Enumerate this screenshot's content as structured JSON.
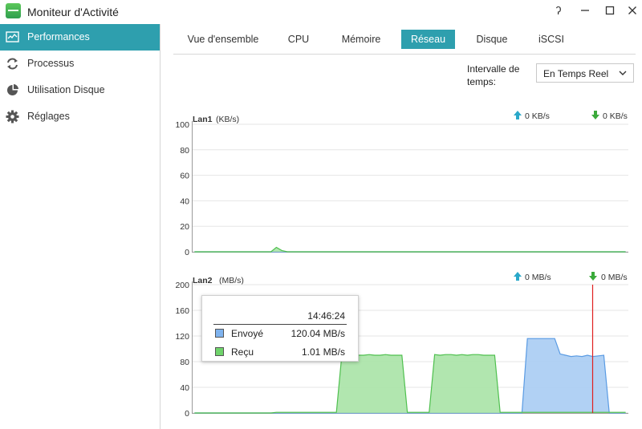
{
  "window": {
    "title": "Moniteur d'Activité",
    "buttons": [
      {
        "name": "help",
        "glyph": "ʔ"
      },
      {
        "name": "minimize"
      },
      {
        "name": "maximize"
      },
      {
        "name": "close"
      }
    ]
  },
  "sidebar": {
    "items": [
      {
        "label": "Performances",
        "icon": "performance-chart-icon",
        "active": true
      },
      {
        "label": "Processus",
        "icon": "refresh-arrows-icon",
        "active": false
      },
      {
        "label": "Utilisation Disque",
        "icon": "disk-pie-icon",
        "active": false
      },
      {
        "label": "Réglages",
        "icon": "gear-icon",
        "active": false
      }
    ]
  },
  "tabs": [
    {
      "label": "Vue d'ensemble",
      "active": false
    },
    {
      "label": "CPU",
      "active": false
    },
    {
      "label": "Mémoire",
      "active": false
    },
    {
      "label": "Réseau",
      "active": true
    },
    {
      "label": "Disque",
      "active": false
    },
    {
      "label": "iSCSI",
      "active": false
    }
  ],
  "interval": {
    "label": "Intervalle de temps:",
    "label_line1": "Intervalle de",
    "label_line2": "temps:",
    "selected": "En Temps Reel"
  },
  "colors": {
    "accent": "#2e9fae",
    "sent_fill": "#a8ccf3",
    "sent_line": "#5a9be3",
    "received_fill": "#a9e3a6",
    "received_line": "#4fc04f",
    "upload_arrow": "#2aa8c9",
    "download_arrow": "#3aaa3a",
    "cursor_line": "#e02020"
  },
  "chart_data": [
    {
      "type": "area",
      "title": "Lan1",
      "unit": "(KB/s)",
      "ylim": [
        0,
        100
      ],
      "yticks": [
        0,
        20,
        40,
        60,
        80,
        100
      ],
      "grid": true,
      "upload_rate": "0 KB/s",
      "download_rate": "0 KB/s",
      "series": [
        {
          "name": "Envoyé",
          "values": [
            0,
            0,
            0,
            0,
            0,
            0,
            0,
            0,
            0,
            0,
            0,
            0,
            0,
            0,
            0,
            0,
            0,
            0,
            0,
            0,
            0,
            0,
            0,
            0,
            0,
            0,
            0,
            0,
            0,
            0,
            0,
            0,
            0,
            0,
            0,
            0,
            0,
            0,
            0,
            0,
            0,
            0,
            0,
            0,
            0,
            0,
            0,
            0,
            0,
            0,
            0,
            0,
            0,
            0,
            0,
            0,
            0,
            0,
            0,
            0,
            0,
            0,
            0,
            0,
            0,
            0,
            0,
            0,
            0,
            0,
            0,
            0,
            0,
            0,
            0,
            0,
            0,
            0,
            0,
            0
          ]
        },
        {
          "name": "Reçu",
          "values": [
            0,
            0,
            0,
            0,
            0,
            0,
            0,
            0,
            0,
            0,
            0,
            0,
            0,
            0,
            0,
            3.5,
            1,
            0,
            0,
            0,
            0,
            0,
            0,
            0,
            0,
            0,
            0,
            0,
            0,
            0,
            0,
            0,
            0,
            0,
            0,
            0,
            0,
            0,
            0,
            0,
            0,
            0,
            0,
            0,
            0,
            0,
            0,
            0,
            0,
            0,
            0,
            0,
            0,
            0,
            0,
            0,
            0,
            0,
            0,
            0,
            0,
            0,
            0,
            0,
            0,
            0,
            0,
            0,
            0,
            0,
            0,
            0,
            0,
            0,
            0,
            0,
            0,
            0,
            0,
            0
          ]
        }
      ]
    },
    {
      "type": "area",
      "title": "Lan2",
      "unit": "(MB/s)",
      "ylim": [
        0,
        200
      ],
      "yticks": [
        0,
        40,
        80,
        120,
        160,
        200
      ],
      "grid": true,
      "upload_rate": "0 MB/s",
      "download_rate": "0 MB/s",
      "series": [
        {
          "name": "Envoyé",
          "values": [
            0,
            0,
            0,
            0,
            0,
            0,
            0,
            0,
            0,
            0,
            0,
            0,
            0,
            0,
            0,
            0,
            0,
            0,
            0,
            0,
            0,
            0,
            0,
            0,
            0,
            0,
            0,
            0,
            0,
            0,
            0,
            0,
            0,
            0,
            0,
            0,
            0,
            0,
            0,
            0,
            0,
            0,
            0,
            0,
            0,
            0,
            0,
            0,
            0,
            0,
            0,
            0,
            0,
            0,
            0,
            0,
            0,
            0,
            0,
            0,
            0,
            116,
            116,
            116,
            116,
            116,
            116,
            92,
            90,
            88,
            89,
            88,
            90,
            88,
            89,
            90,
            0,
            0,
            0,
            0
          ]
        },
        {
          "name": "Reçu",
          "values": [
            0,
            0,
            0,
            0,
            0,
            0,
            0,
            0,
            0,
            0,
            0,
            0,
            0,
            0,
            0,
            1,
            1,
            1,
            1,
            1,
            1,
            1,
            1,
            1,
            1,
            1,
            1,
            91,
            90,
            91,
            90,
            90,
            91,
            90,
            90,
            91,
            90,
            90,
            90,
            1,
            1,
            1,
            1,
            1,
            91,
            90,
            91,
            91,
            90,
            91,
            90,
            91,
            91,
            90,
            90,
            90,
            1,
            1,
            1,
            1,
            1,
            1,
            1,
            1,
            1,
            1,
            1,
            1,
            1,
            1,
            1,
            1,
            1,
            1,
            1,
            1,
            1,
            1,
            1,
            1
          ]
        }
      ],
      "tooltip": {
        "time": "14:46:24",
        "rows": [
          {
            "name": "Envoyé",
            "value": "120.04 MB/s"
          },
          {
            "name": "Reçu",
            "value": "1.01 MB/s"
          }
        ]
      }
    }
  ]
}
